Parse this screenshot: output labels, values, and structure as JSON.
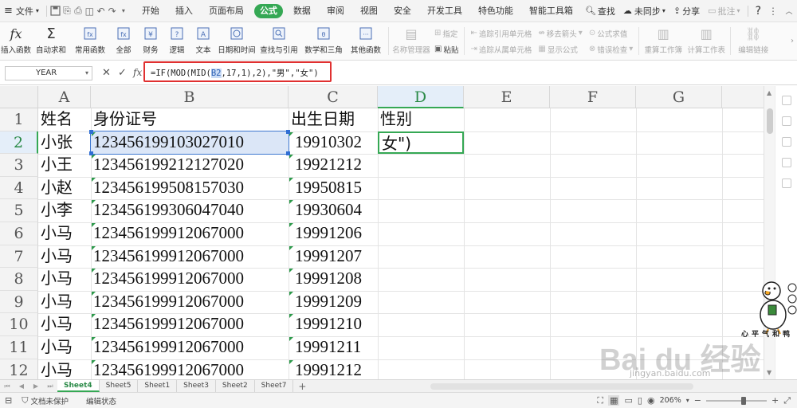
{
  "menubar": {
    "file_label": "文件",
    "tabs": [
      {
        "label": "开始",
        "active": false
      },
      {
        "label": "插入",
        "active": false
      },
      {
        "label": "页面布局",
        "active": false
      },
      {
        "label": "公式",
        "active": true
      },
      {
        "label": "数据",
        "active": false
      },
      {
        "label": "审阅",
        "active": false
      },
      {
        "label": "视图",
        "active": false
      },
      {
        "label": "安全",
        "active": false
      },
      {
        "label": "开发工具",
        "active": false
      },
      {
        "label": "特色功能",
        "active": false
      },
      {
        "label": "智能工具箱",
        "active": false
      }
    ],
    "search_label": "查找",
    "sync_label": "未同步",
    "share_label": "分享",
    "comment_label": "批注",
    "help_label": "?"
  },
  "ribbon": {
    "insert_function": "插入函数",
    "autosum": "自动求和",
    "common": "常用函数",
    "all": "全部",
    "finance": "财务",
    "logic": "逻辑",
    "text": "文本",
    "datetime": "日期和时间",
    "lookup": "查找与引用",
    "math": "数学和三角",
    "other": "其他函数",
    "name_manager": "名称管理器",
    "define": "指定",
    "paste": "粘贴",
    "trace_precedents": "追踪引用单元格",
    "trace_dependents": "追踪从属单元格",
    "remove_arrows": "移去箭头",
    "show_formulas": "显示公式",
    "evaluate": "公式求值",
    "error_check": "错误检查",
    "recalc": "重算工作簿",
    "calc_sheet": "计算工作表",
    "edit_links": "编辑链接"
  },
  "formulabar": {
    "namebox": "YEAR",
    "formula_pre": "=IF(MOD(MID(",
    "formula_ref": "B2",
    "formula_post": ",17,1),2),\"男\",\"女\")"
  },
  "columns": [
    "A",
    "B",
    "C",
    "D",
    "E",
    "F",
    "G"
  ],
  "rows": [
    {
      "num": "1",
      "a": "姓名",
      "b": "身份证号",
      "c": "出生日期",
      "d": "性别"
    },
    {
      "num": "2",
      "a": "小张",
      "b": "123456199103027010",
      "c": "19910302",
      "d": "女\")"
    },
    {
      "num": "3",
      "a": "小王",
      "b": "123456199212127020",
      "c": "19921212",
      "d": ""
    },
    {
      "num": "4",
      "a": "小赵",
      "b": "123456199508157030",
      "c": "19950815",
      "d": ""
    },
    {
      "num": "5",
      "a": "小李",
      "b": "123456199306047040",
      "c": "19930604",
      "d": ""
    },
    {
      "num": "6",
      "a": "小马",
      "b": "123456199912067000",
      "c": "19991206",
      "d": ""
    },
    {
      "num": "7",
      "a": "小马",
      "b": "123456199912067000",
      "c": "19991207",
      "d": ""
    },
    {
      "num": "8",
      "a": "小马",
      "b": "123456199912067000",
      "c": "19991208",
      "d": ""
    },
    {
      "num": "9",
      "a": "小马",
      "b": "123456199912067000",
      "c": "19991209",
      "d": ""
    },
    {
      "num": "10",
      "a": "小马",
      "b": "123456199912067000",
      "c": "19991210",
      "d": ""
    },
    {
      "num": "11",
      "a": "小马",
      "b": "123456199912067000",
      "c": "19991211",
      "d": ""
    },
    {
      "num": "12",
      "a": "小马",
      "b": "123456199912067000",
      "c": "19991212",
      "d": ""
    }
  ],
  "sheets": [
    {
      "label": "Sheet4",
      "active": true
    },
    {
      "label": "Sheet5",
      "active": false
    },
    {
      "label": "Sheet1",
      "active": false
    },
    {
      "label": "Sheet3",
      "active": false
    },
    {
      "label": "Sheet2",
      "active": false
    },
    {
      "label": "Sheet7",
      "active": false
    }
  ],
  "statusbar": {
    "protect": "文档未保护",
    "mode": "编辑状态",
    "zoom": "206%"
  },
  "watermark": {
    "baidu": "Bai du 经验",
    "url": "jingyan.baidu.com",
    "duck_text": "心平气和鸭"
  },
  "colors": {
    "accent": "#35a854",
    "highlight_box": "#e03030",
    "selection": "#dbe6f7"
  }
}
